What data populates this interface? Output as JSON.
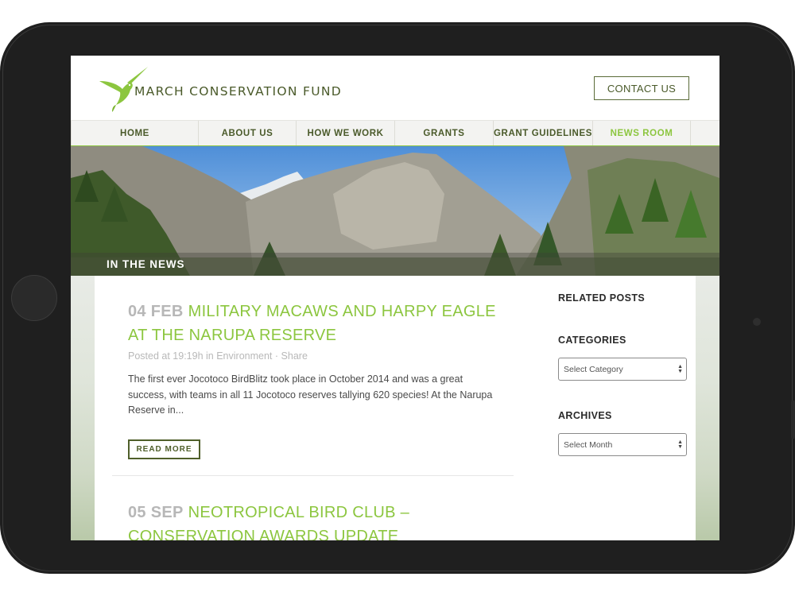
{
  "site": {
    "logo_text": "MARCH CONSERVATION FUND",
    "contact_label": "CONTACT US"
  },
  "nav": {
    "items": [
      {
        "label": "HOME"
      },
      {
        "label": "ABOUT US"
      },
      {
        "label": "HOW WE WORK"
      },
      {
        "label": "GRANTS"
      },
      {
        "label": "GRANT GUIDELINES"
      },
      {
        "label": "NEWS ROOM"
      }
    ],
    "active": "NEWS ROOM"
  },
  "hero": {
    "title": "IN THE NEWS"
  },
  "posts": [
    {
      "date": "04 FEB",
      "title": "MILITARY MACAWS AND HARPY EAGLE AT THE NARUPA RESERVE",
      "meta_posted": "Posted at 19:19h in",
      "meta_category": "Environment",
      "meta_sep": "·",
      "meta_share": "Share",
      "excerpt": "The first ever Jocotoco BirdBlitz took place in October 2014 and was a great success, with teams in all 11 Jocotoco reserves tallying 620 species! At the Narupa Reserve in...",
      "read_more": "READ MORE"
    },
    {
      "date": "05 SEP",
      "title": "NEOTROPICAL BIRD CLUB – CONSERVATION AWARDS UPDATE"
    }
  ],
  "sidebar": {
    "related_heading": "RELATED POSTS",
    "categories_heading": "CATEGORIES",
    "categories_select": "Select Category",
    "archives_heading": "ARCHIVES",
    "archives_select": "Select Month"
  },
  "colors": {
    "accent": "#8cc63f",
    "dark_green": "#4a5a2a",
    "device": "#1f1f1f"
  },
  "icons": [
    "hummingbird-logo-icon",
    "select-arrows-icon"
  ]
}
